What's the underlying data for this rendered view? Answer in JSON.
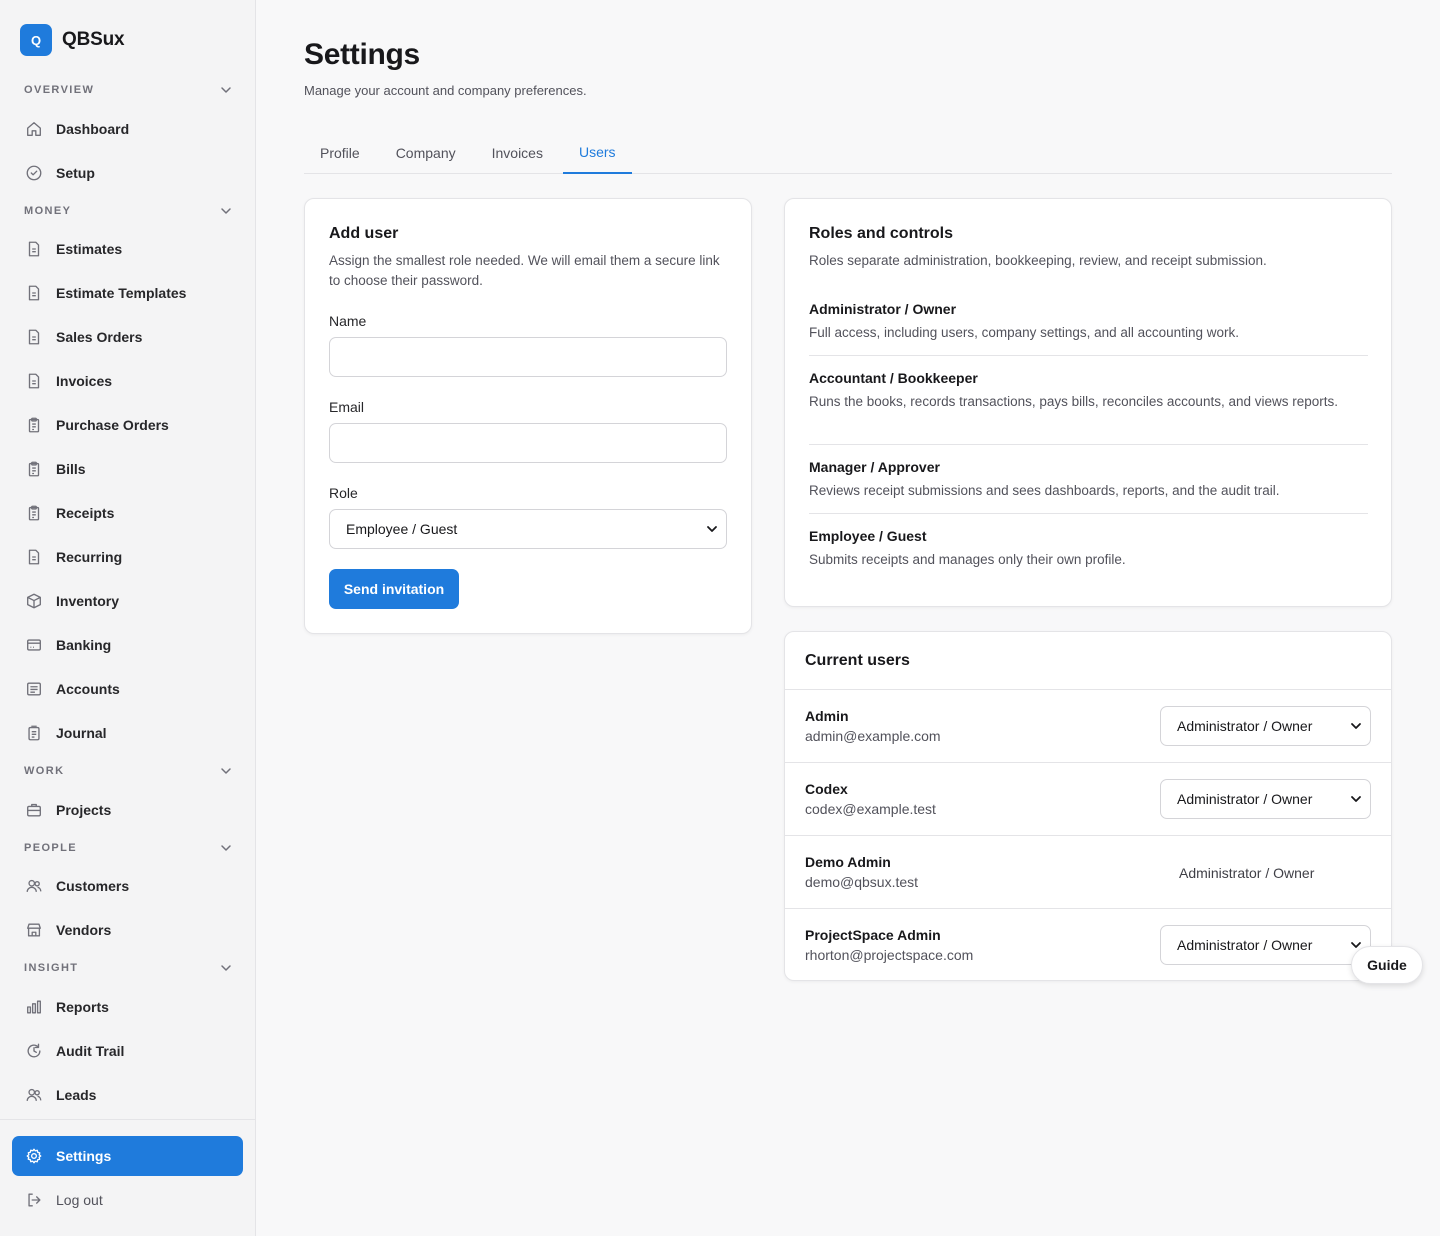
{
  "brand": {
    "logo_letter": "Q",
    "name": "QBSux"
  },
  "sidebar": {
    "groups": {
      "overview": "OVERVIEW",
      "money": "MONEY",
      "work": "WORK",
      "people": "PEOPLE",
      "insight": "INSIGHT"
    },
    "items": {
      "dashboard": "Dashboard",
      "setup": "Setup",
      "estimates": "Estimates",
      "estimate_templates": "Estimate Templates",
      "sales_orders": "Sales Orders",
      "invoices": "Invoices",
      "purchase_orders": "Purchase Orders",
      "bills": "Bills",
      "receipts": "Receipts",
      "recurring": "Recurring",
      "inventory": "Inventory",
      "banking": "Banking",
      "accounts": "Accounts",
      "journal": "Journal",
      "projects": "Projects",
      "customers": "Customers",
      "vendors": "Vendors",
      "reports": "Reports",
      "audit_trail": "Audit Trail",
      "leads": "Leads",
      "settings": "Settings",
      "logout": "Log out"
    },
    "active_item": "Settings"
  },
  "page": {
    "title": "Settings",
    "subtitle": "Manage your account and company preferences."
  },
  "tabs": [
    "Profile",
    "Company",
    "Invoices",
    "Users"
  ],
  "active_tab": "Users",
  "add_user": {
    "title": "Add user",
    "description": "Assign the smallest role needed. We will email them a secure link to choose their password.",
    "name_label": "Name",
    "name_value": "",
    "email_label": "Email",
    "email_value": "",
    "role_label": "Role",
    "role_value": "Employee / Guest",
    "submit_label": "Send invitation"
  },
  "roles": {
    "title": "Roles and controls",
    "description": "Roles separate administration, bookkeeping, review, and receipt submission.",
    "list": [
      {
        "name": "Administrator / Owner",
        "desc": "Full access, including users, company settings, and all accounting work."
      },
      {
        "name": "Accountant / Bookkeeper",
        "desc": "Runs the books, records transactions, pays bills, reconciles accounts, and views reports."
      },
      {
        "name": "Manager / Approver",
        "desc": "Reviews receipt submissions and sees dashboards, reports, and the audit trail."
      },
      {
        "name": "Employee / Guest",
        "desc": "Submits receipts and manages only their own profile."
      }
    ]
  },
  "current_users": {
    "title": "Current users",
    "list": [
      {
        "name": "Admin",
        "email": "admin@example.com",
        "role": "Administrator / Owner",
        "editable": true
      },
      {
        "name": "Codex",
        "email": "codex@example.test",
        "role": "Administrator / Owner",
        "editable": true
      },
      {
        "name": "Demo Admin",
        "email": "demo@qbsux.test",
        "role": "Administrator / Owner",
        "editable": false
      },
      {
        "name": "ProjectSpace Admin",
        "email": "rhorton@projectspace.com",
        "role": "Administrator / Owner",
        "editable": true
      }
    ]
  },
  "guide_label": "Guide",
  "colors": {
    "accent": "#1f7bdc",
    "sidebar_bg": "#f4f4f5",
    "page_bg": "#f8f8f9",
    "border": "#e4e4e7"
  }
}
